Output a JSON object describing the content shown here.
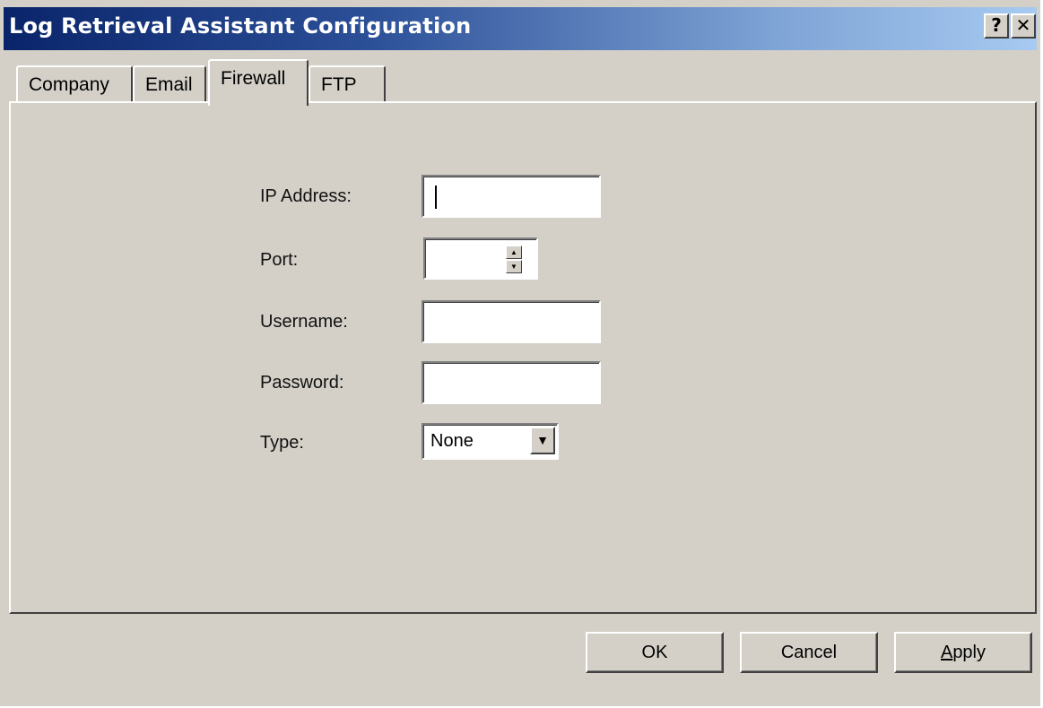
{
  "window": {
    "title": "Log Retrieval Assistant Configuration",
    "help_glyph": "?",
    "close_glyph": "✕"
  },
  "tabs": [
    {
      "label": "Company",
      "active": false
    },
    {
      "label": "Email",
      "active": false
    },
    {
      "label": "Firewall",
      "active": true
    },
    {
      "label": "FTP",
      "active": false
    }
  ],
  "form": {
    "ip_label": "IP Address:",
    "ip_value": "",
    "port_label": "Port:",
    "port_value": "",
    "username_label": "Username:",
    "username_value": "",
    "password_label": "Password:",
    "password_value": "",
    "type_label": "Type:",
    "type_value": "None"
  },
  "buttons": {
    "ok": "OK",
    "cancel": "Cancel",
    "apply_first": "A",
    "apply_rest": "pply"
  },
  "icons": {
    "spin_up": "▲",
    "spin_down": "▼",
    "dropdown": "▼"
  },
  "colors": {
    "face": "#d4d0c8",
    "title_start": "#0a246a",
    "title_end": "#a6caf0"
  }
}
